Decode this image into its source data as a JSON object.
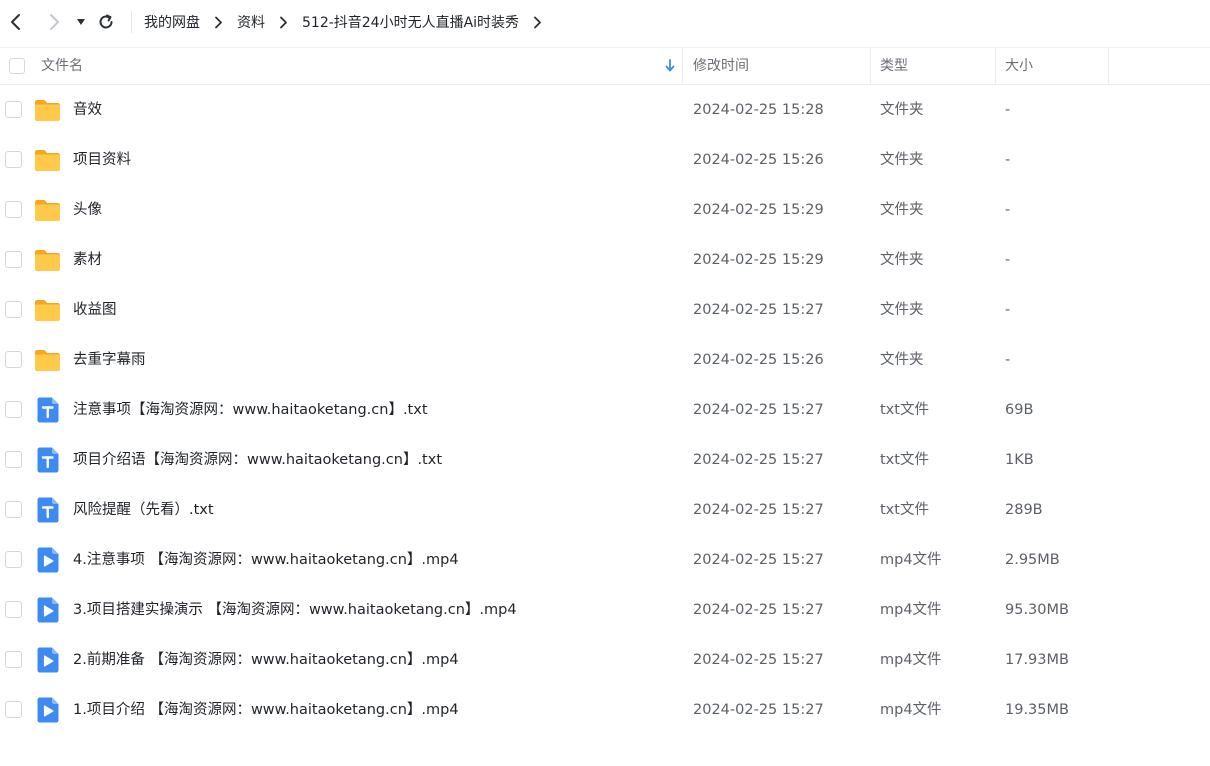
{
  "breadcrumb": [
    "我的网盘",
    "资料",
    "512-抖音24小时无人直播Ai时装秀"
  ],
  "columns": {
    "name": "文件名",
    "modified": "修改时间",
    "type": "类型",
    "size": "大小"
  },
  "colors": {
    "folder": "#FFC233",
    "txt": "#3D8BF2",
    "video": "#3D8BF2",
    "text": "#1f2329",
    "muted": "#5c6067"
  },
  "rows": [
    {
      "icon": "folder-icon",
      "name": "音效",
      "modified": "2024-02-25 15:28",
      "type": "文件夹",
      "size": "-"
    },
    {
      "icon": "folder-icon",
      "name": "项目资料",
      "modified": "2024-02-25 15:26",
      "type": "文件夹",
      "size": "-"
    },
    {
      "icon": "folder-icon",
      "name": "头像",
      "modified": "2024-02-25 15:29",
      "type": "文件夹",
      "size": "-"
    },
    {
      "icon": "folder-icon",
      "name": "素材",
      "modified": "2024-02-25 15:29",
      "type": "文件夹",
      "size": "-"
    },
    {
      "icon": "folder-icon",
      "name": "收益图",
      "modified": "2024-02-25 15:27",
      "type": "文件夹",
      "size": "-"
    },
    {
      "icon": "folder-icon",
      "name": "去重字幕雨",
      "modified": "2024-02-25 15:26",
      "type": "文件夹",
      "size": "-"
    },
    {
      "icon": "txt-file-icon",
      "name": "注意事项【海淘资源网：www.haitaoketang.cn】.txt",
      "modified": "2024-02-25 15:27",
      "type": "txt文件",
      "size": "69B"
    },
    {
      "icon": "txt-file-icon",
      "name": "项目介绍语【海淘资源网：www.haitaoketang.cn】.txt",
      "modified": "2024-02-25 15:27",
      "type": "txt文件",
      "size": "1KB"
    },
    {
      "icon": "txt-file-icon",
      "name": "风险提醒（先看）.txt",
      "modified": "2024-02-25 15:27",
      "type": "txt文件",
      "size": "289B"
    },
    {
      "icon": "video-file-icon",
      "name": "4.注意事项 【海淘资源网：www.haitaoketang.cn】.mp4",
      "modified": "2024-02-25 15:27",
      "type": "mp4文件",
      "size": "2.95MB"
    },
    {
      "icon": "video-file-icon",
      "name": "3.项目搭建实操演示 【海淘资源网：www.haitaoketang.cn】.mp4",
      "modified": "2024-02-25 15:27",
      "type": "mp4文件",
      "size": "95.30MB"
    },
    {
      "icon": "video-file-icon",
      "name": "2.前期准备 【海淘资源网：www.haitaoketang.cn】.mp4",
      "modified": "2024-02-25 15:27",
      "type": "mp4文件",
      "size": "17.93MB"
    },
    {
      "icon": "video-file-icon",
      "name": "1.项目介绍 【海淘资源网：www.haitaoketang.cn】.mp4",
      "modified": "2024-02-25 15:27",
      "type": "mp4文件",
      "size": "19.35MB"
    }
  ]
}
